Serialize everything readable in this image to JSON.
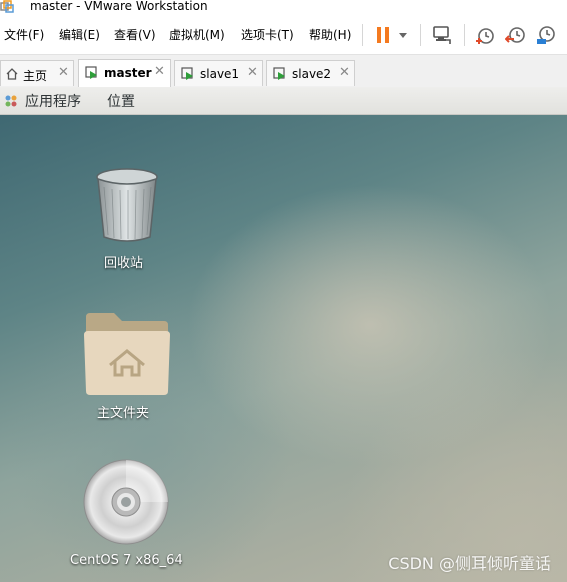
{
  "window": {
    "title": "master - VMware Workstation",
    "icon": "vmware-logo-icon"
  },
  "menu": {
    "items": [
      {
        "label": "文件(F)"
      },
      {
        "label": "编辑(E)"
      },
      {
        "label": "查看(V)"
      },
      {
        "label": "虚拟机(M)"
      },
      {
        "label": "选项卡(T)"
      },
      {
        "label": "帮助(H)"
      }
    ]
  },
  "toolbar": {
    "icons": [
      "pause-icon",
      "dropdown-arrow-icon",
      "send-ctrl-alt-del-icon",
      "snapshot-icon",
      "revert-snapshot-icon",
      "manage-snapshots-icon"
    ],
    "colors": {
      "pause": "#f47a20",
      "snapshot": "#e04a2a"
    }
  },
  "tabs": [
    {
      "label": "主页",
      "icon": "home-icon",
      "active": false
    },
    {
      "label": "master",
      "icon": "vm-play-icon",
      "active": true
    },
    {
      "label": "slave1",
      "icon": "vm-play-icon",
      "active": false
    },
    {
      "label": "slave2",
      "icon": "vm-play-icon",
      "active": false
    }
  ],
  "gnome_panel": {
    "applications": "应用程序",
    "places": "位置"
  },
  "desktop": {
    "icons": [
      {
        "label": "回收站",
        "icon": "trash-icon"
      },
      {
        "label": "主文件夹",
        "icon": "home-folder-icon"
      },
      {
        "label": "CentOS 7 x86_64",
        "icon": "cd-disc-icon"
      }
    ],
    "watermark": "CSDN @侧耳倾听童话"
  }
}
